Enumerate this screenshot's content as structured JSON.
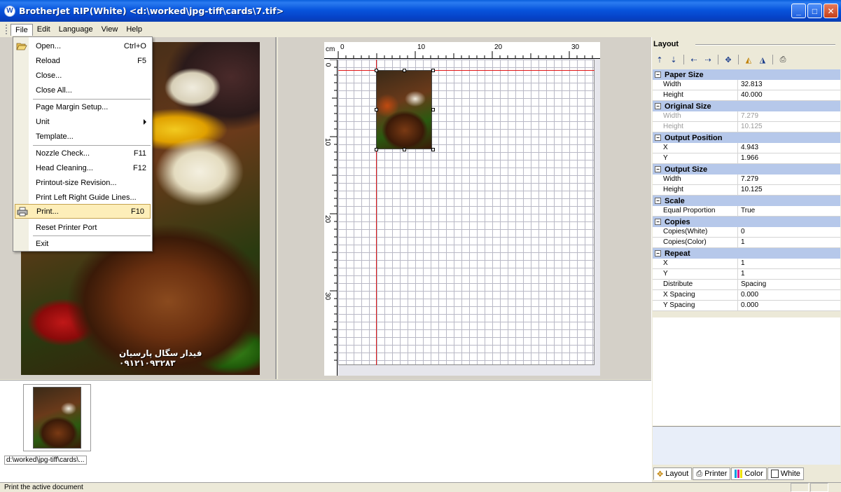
{
  "window": {
    "icon_letter": "W",
    "title": "BrotherJet RIP(White) <d:\\worked\\jpg-tiff\\cards\\7.tif>",
    "minimize": "_",
    "maximize": "□",
    "close": "✕"
  },
  "menubar": {
    "items": [
      {
        "label": "File"
      },
      {
        "label": "Edit"
      },
      {
        "label": "Language"
      },
      {
        "label": "View"
      },
      {
        "label": "Help"
      }
    ]
  },
  "file_menu": {
    "items": [
      {
        "label": "Open...",
        "shortcut": "Ctrl+O",
        "icon": "folder-open-icon"
      },
      {
        "label": "Reload",
        "shortcut": "F5"
      },
      {
        "label": "Close...",
        "shortcut": ""
      },
      {
        "label": "Close All...",
        "shortcut": ""
      },
      {
        "label": "Page Margin Setup...",
        "shortcut": ""
      },
      {
        "label": "Unit",
        "shortcut": "",
        "submenu": true
      },
      {
        "label": "Template...",
        "shortcut": ""
      },
      {
        "label": "Nozzle Check...",
        "shortcut": "F11"
      },
      {
        "label": "Head Cleaning...",
        "shortcut": "F12"
      },
      {
        "label": "Printout-size Revision...",
        "shortcut": ""
      },
      {
        "label": "Print Left Right Guide Lines...",
        "shortcut": ""
      },
      {
        "label": "Print...",
        "shortcut": "F10",
        "icon": "printer-icon",
        "highlighted": true
      },
      {
        "label": "Reset Printer Port",
        "shortcut": ""
      },
      {
        "label": "Exit",
        "shortcut": ""
      }
    ]
  },
  "preview": {
    "caption": "فیدار سگال پارسیان ۰۹۱۲۱۰۹۳۲۸۳"
  },
  "canvas": {
    "unit": "cm",
    "top_ticks": [
      "0",
      "10",
      "20",
      "30"
    ],
    "left_ticks": [
      "0",
      "10",
      "20",
      "30"
    ]
  },
  "layout_panel": {
    "title": "Layout",
    "categories": [
      {
        "name": "Paper Size",
        "rows": [
          {
            "key": "Width",
            "value": "32.813",
            "disabled": false
          },
          {
            "key": "Height",
            "value": "40.000",
            "disabled": false
          }
        ]
      },
      {
        "name": "Original Size",
        "rows": [
          {
            "key": "Width",
            "value": "7.279",
            "disabled": true
          },
          {
            "key": "Height",
            "value": "10.125",
            "disabled": true
          }
        ]
      },
      {
        "name": "Output Position",
        "rows": [
          {
            "key": "X",
            "value": "4.943",
            "disabled": false
          },
          {
            "key": "Y",
            "value": "1.966",
            "disabled": false
          }
        ]
      },
      {
        "name": "Output Size",
        "rows": [
          {
            "key": "Width",
            "value": "7.279",
            "disabled": false
          },
          {
            "key": "Height",
            "value": "10.125",
            "disabled": false
          }
        ]
      },
      {
        "name": "Scale",
        "rows": [
          {
            "key": "Equal Proportion",
            "value": "True",
            "disabled": false
          }
        ]
      },
      {
        "name": "Copies",
        "rows": [
          {
            "key": "Copies(White)",
            "value": "0",
            "disabled": false
          },
          {
            "key": "Copies(Color)",
            "value": "1",
            "disabled": false
          }
        ]
      },
      {
        "name": "Repeat",
        "rows": [
          {
            "key": "X",
            "value": "1",
            "disabled": false
          },
          {
            "key": "Y",
            "value": "1",
            "disabled": false
          },
          {
            "key": "Distribute",
            "value": "Spacing",
            "disabled": false
          },
          {
            "key": "X Spacing",
            "value": "0.000",
            "disabled": false
          },
          {
            "key": "Y Spacing",
            "value": "0.000",
            "disabled": false
          }
        ]
      }
    ],
    "tabs": [
      {
        "label": "Layout",
        "icon": "layout-icon"
      },
      {
        "label": "Printer",
        "icon": "printer-icon"
      },
      {
        "label": "Color",
        "icon": "color-bars-icon"
      },
      {
        "label": "White",
        "icon": "white-box-icon"
      }
    ]
  },
  "thumbnails": [
    {
      "caption": "d:\\worked\\jpg-tiff\\cards\\..."
    }
  ],
  "status": {
    "text": "Print the active document"
  }
}
